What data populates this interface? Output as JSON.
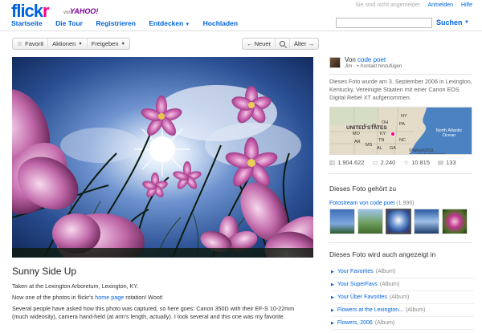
{
  "brand": {
    "logo_part1": "flick",
    "logo_part2": "r",
    "von": "von",
    "yahoo": "YAHOO!"
  },
  "toplinks": {
    "status": "Sie sind nicht angemeldet",
    "login": "Anmelden",
    "help": "Hilfe"
  },
  "nav": [
    {
      "label": "Startseite"
    },
    {
      "label": "Die Tour"
    },
    {
      "label": "Registrieren"
    },
    {
      "label": "Entdecken"
    },
    {
      "label": "Hochladen"
    }
  ],
  "search": {
    "placeholder": "",
    "button": "Suchen"
  },
  "toolbar": {
    "favorite": "Favorit",
    "actions": "Aktionen",
    "share": "Freigeben",
    "newer": "← Neuer",
    "older": "Älter →"
  },
  "photo": {
    "title": "Sunny Side Up",
    "desc1": "Taken at the Lexington Arboretum, Lexington, KY.",
    "desc2_pre": "Now one of the photos in flickr's ",
    "desc2_link": "home page",
    "desc2_post": " rotation! Woot!",
    "desc3": "Several people have asked how this photo was captured, so here goes: Canon 350D with their EF-S 10-22mm (much wideosity), camera hand-held (at arm's length, actually). I took several and this one was my favorite."
  },
  "owner": {
    "von": "Von ",
    "name": "code poet",
    "sub_name": "Jim",
    "sub_add": "+ Kontakt hinzufügen"
  },
  "taken": "Dieses Foto wurde am 3. September 2006 in Lexington, Kentucky, Vereinigte Staaten mit einer Canon EOS Digital Rebel XT aufgenommen.",
  "map": {
    "country": "UNITED STATES",
    "ocean": "North Atlantic Ocean",
    "copyright": "©Yahoo!2010, Data©NAVTEQ2009",
    "states": [
      "NY",
      "PA",
      "OH",
      "KY",
      "TN",
      "NC",
      "GA",
      "AL",
      "MS",
      "IL",
      "IN",
      "MO",
      "AR"
    ]
  },
  "stats": {
    "views": "1.904.622",
    "comments": "2.240",
    "favorites": "10.815",
    "notes": "133"
  },
  "belongs": {
    "heading": "Dieses Foto gehört zu",
    "stream_label": "Fotostream von code poet",
    "stream_count": "(1.996)"
  },
  "also": {
    "heading": "Dieses Foto wird auch angezeigt in",
    "items": [
      {
        "label": "Your Favorites",
        "kind": "(Album)"
      },
      {
        "label": "Your SuperFavs",
        "kind": "(Album)"
      },
      {
        "label": "Your Über Favorites",
        "kind": "(Album)"
      },
      {
        "label": "Flowers at the Lexington...",
        "kind": "(Album)"
      },
      {
        "label": "Flowers, 2006",
        "kind": "(Album)"
      }
    ]
  },
  "colors": {
    "flickr_blue": "#0063dc",
    "flickr_pink": "#ff0084",
    "yahoo_purple": "#7b0099"
  }
}
